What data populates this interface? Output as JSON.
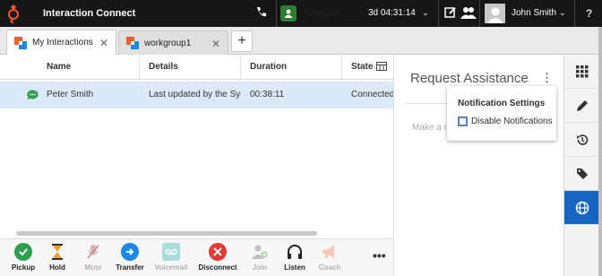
{
  "header": {
    "app_title": "Interaction Connect",
    "status_label": "Available",
    "status_time": "3d 04:31:14",
    "user_name": "John Smith",
    "help": "?"
  },
  "tabs": [
    {
      "label": "My Interactions"
    },
    {
      "label": "workgroup1"
    }
  ],
  "table": {
    "columns": [
      "Name",
      "Details",
      "Duration",
      "State"
    ],
    "rows": [
      {
        "name": "Peter Smith",
        "details": "Last updated by the System",
        "duration": "00:38:11",
        "state": "Connected"
      }
    ]
  },
  "panel": {
    "title": "Request Assistance",
    "input_placeholder": "Make a re"
  },
  "popup": {
    "title": "Notification Settings",
    "checkbox_label": "Disable Notifications",
    "checked": false
  },
  "toolbar": {
    "buttons": [
      {
        "label": "Pickup",
        "enabled": true
      },
      {
        "label": "Hold",
        "enabled": true
      },
      {
        "label": "Mute",
        "enabled": false
      },
      {
        "label": "Transfer",
        "enabled": true
      },
      {
        "label": "Voicemail",
        "enabled": false
      },
      {
        "label": "Disconnect",
        "enabled": true
      },
      {
        "label": "Join",
        "enabled": false
      },
      {
        "label": "Listen",
        "enabled": true
      },
      {
        "label": "Coach",
        "enabled": false
      }
    ]
  },
  "colors": {
    "header_bg": "#161616",
    "accent": "#1565c0",
    "selected_row": "#dbe9f8",
    "available_green": "#2e7d32",
    "logo_orange": "#f05a28"
  },
  "icons": {
    "logo": "genesys-logo-icon",
    "phone": "phone-icon",
    "edit": "edit-icon",
    "people": "people-icon",
    "chat": "chat-icon",
    "columns": "column-picker-icon",
    "rail": [
      "grid-icon",
      "pencil-icon",
      "history-icon",
      "tag-icon",
      "globe-icon"
    ]
  }
}
